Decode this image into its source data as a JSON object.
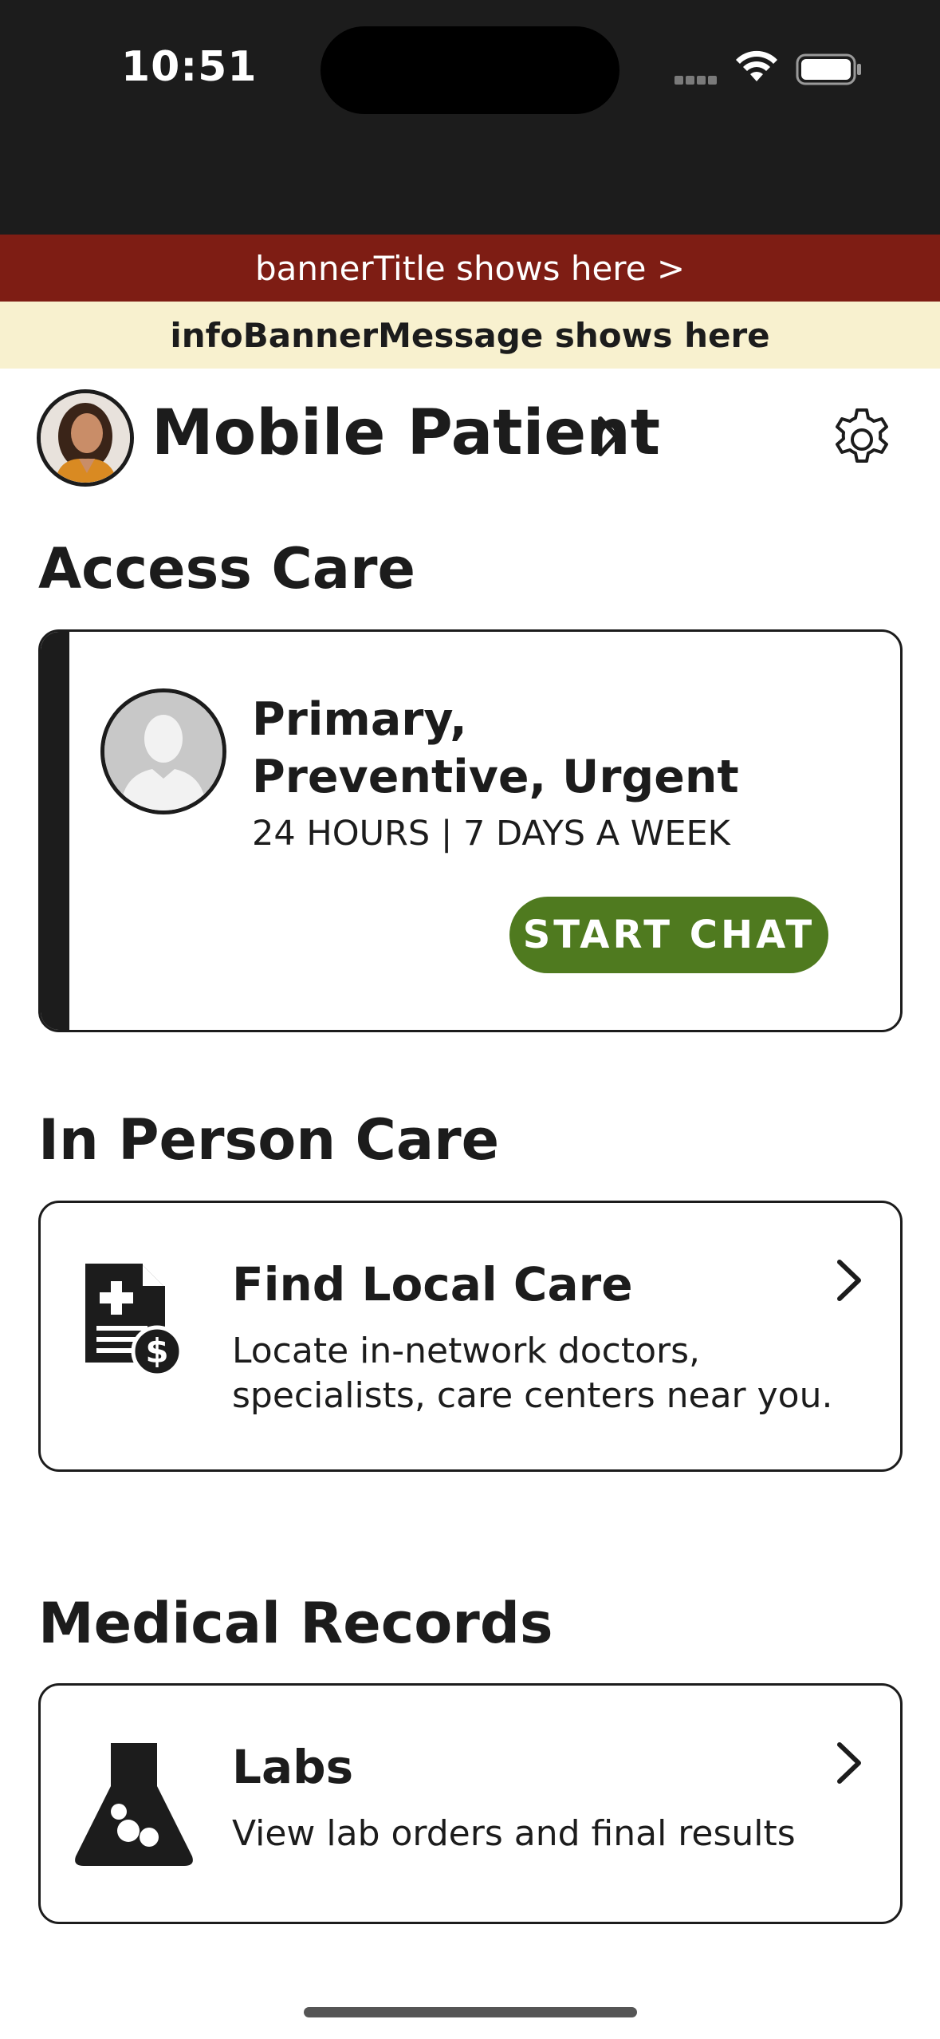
{
  "status_bar": {
    "time": "10:51"
  },
  "banner": {
    "title": "bannerTitle shows here  >"
  },
  "info_banner": {
    "message": "infoBannerMessage shows here"
  },
  "profile": {
    "name": "Mobile Patient"
  },
  "sections": {
    "access_care": {
      "title": "Access Care",
      "card": {
        "title": "Primary, Preventive, Urgent",
        "hours": "24 HOURS | 7 DAYS A WEEK",
        "button": "START CHAT"
      }
    },
    "in_person_care": {
      "title": "In Person Care",
      "card": {
        "title": "Find Local Care",
        "description": "Locate in-network doctors, specialists, care centers near you."
      }
    },
    "medical_records": {
      "title": "Medical Records",
      "card": {
        "title": "Labs",
        "description": "View lab orders and final results"
      }
    }
  },
  "icons": {
    "settings": "gear-icon",
    "profile_chevron": "chevron-right-icon",
    "find_care": "medical-document-dollar-icon",
    "labs": "lab-flask-icon"
  },
  "colors": {
    "status_bar": "#1c1c1c",
    "banner": "#7e1d14",
    "info_banner": "#f8f1cf",
    "start_chat": "#4f7a1f",
    "text": "#1c1c1c"
  }
}
